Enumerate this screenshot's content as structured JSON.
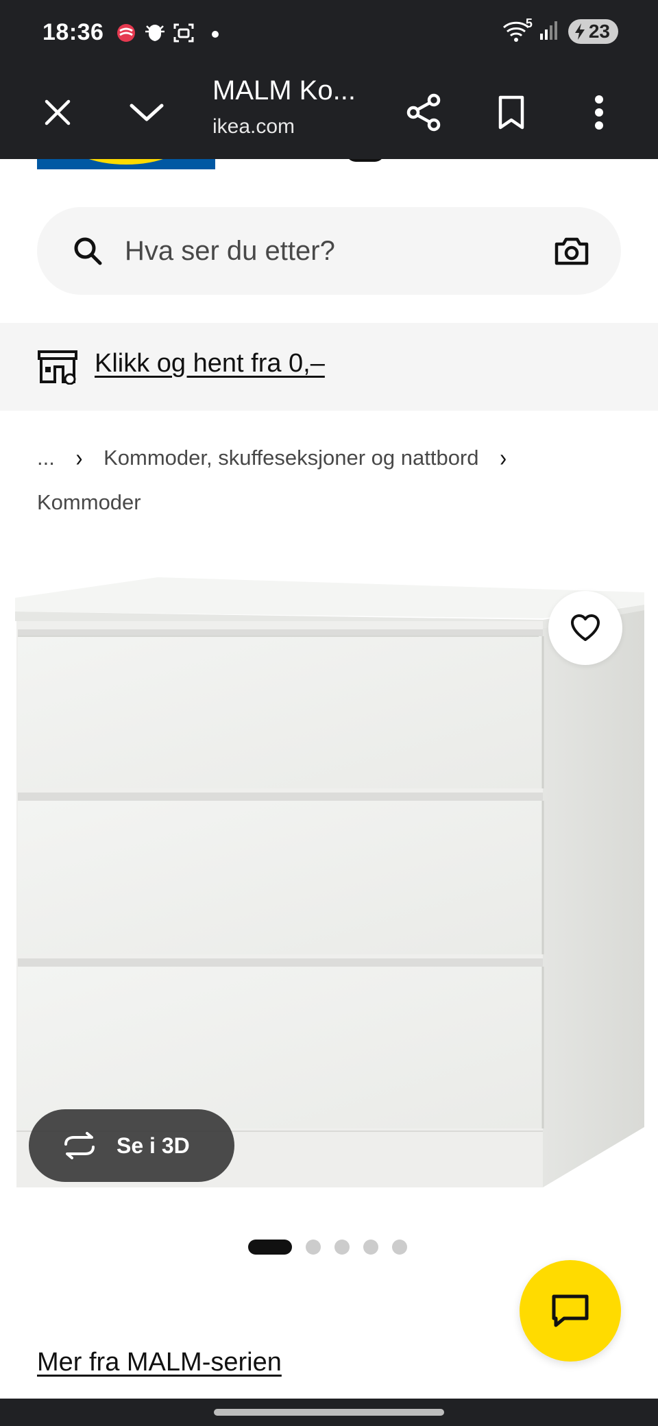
{
  "status_bar": {
    "time": "18:36",
    "notification_icons": [
      "app-swirl-icon",
      "bug-shield-icon",
      "screenshot-icon"
    ],
    "wifi_label": "5",
    "battery": "23"
  },
  "browser": {
    "page_title": "MALM Ko...",
    "domain": "ikea.com",
    "icons": [
      "close-icon",
      "chevron-down-icon",
      "share-icon",
      "bookmark-icon",
      "more-vert-icon"
    ]
  },
  "search": {
    "placeholder": "Hva ser du etter?"
  },
  "promo": {
    "link_text": "Klikk og hent fra 0,–"
  },
  "breadcrumb": {
    "ellipsis": "...",
    "items": [
      "Kommoder, skuffeseksjoner og nattbord",
      "Kommoder"
    ]
  },
  "product": {
    "view_3d_label": "Se i 3D",
    "carousel_total": 5,
    "carousel_active": 1
  },
  "series_link": "Mer fra MALM-serien",
  "colors": {
    "chrome_dark": "#202124",
    "ikea_blue": "#0058a3",
    "ikea_yellow": "#ffdb00",
    "surface_grey": "#f5f5f5"
  }
}
